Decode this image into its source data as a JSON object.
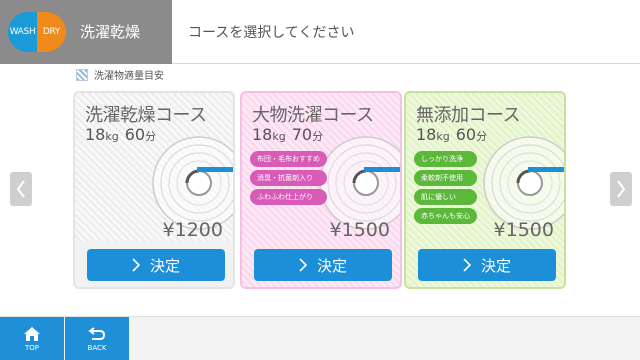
{
  "logo": {
    "left": "WASH",
    "right": "DRY"
  },
  "header": {
    "title": "洗濯乾燥",
    "message": "コースを選択してください"
  },
  "legend": {
    "label": "洗濯物適量目安"
  },
  "courses": [
    {
      "name": "洗濯乾燥コース",
      "capacity": "18",
      "capacity_unit": "kg",
      "time": "60",
      "time_unit": "分",
      "tags": [],
      "price": "¥1200",
      "button": "決定",
      "fill": 0.6
    },
    {
      "name": "大物洗濯コース",
      "capacity": "18",
      "capacity_unit": "kg",
      "time": "70",
      "time_unit": "分",
      "tags": [
        "布団・毛布おすすめ",
        "消臭・抗菌剤入り",
        "ふわふわ仕上がり"
      ],
      "price": "¥1500",
      "button": "決定",
      "fill": 0.6
    },
    {
      "name": "無添加コース",
      "capacity": "18",
      "capacity_unit": "kg",
      "time": "60",
      "time_unit": "分",
      "tags": [
        "しっかり洗浄",
        "柔軟剤不使用",
        "肌に優しい",
        "赤ちゃんも安心"
      ],
      "price": "¥1500",
      "button": "決定",
      "fill": 0.6
    }
  ],
  "footer": {
    "top_label": "TOP",
    "back_label": "BACK"
  },
  "colors": {
    "accent": "#1c8fd8",
    "wash": "#1a9ad6",
    "dry": "#f08a1c",
    "pink_tag": "#d85bb7",
    "green_tag": "#5cb83a"
  },
  "icons": {
    "prev": "chevron-left-icon",
    "next": "chevron-right-icon",
    "home": "home-icon",
    "back": "return-icon"
  }
}
